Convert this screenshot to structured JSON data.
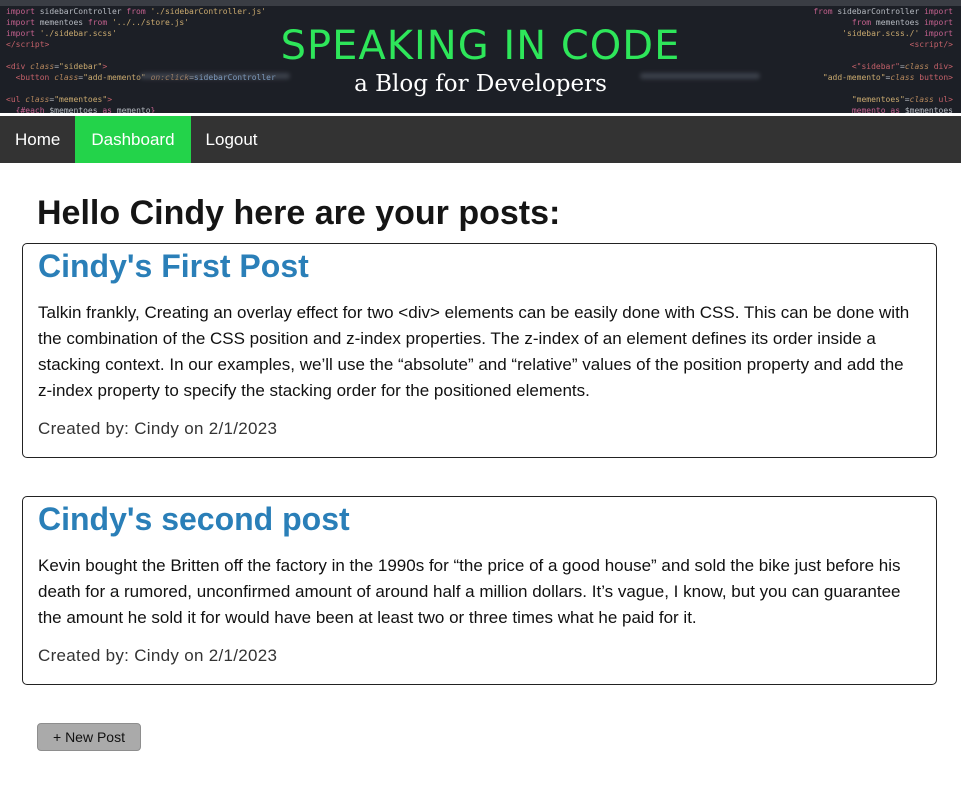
{
  "header": {
    "title": "SPEAKING IN CODE",
    "subtitle": "a Blog for Developers"
  },
  "nav": {
    "items": [
      {
        "label": "Home"
      },
      {
        "label": "Dashboard"
      },
      {
        "label": "Logout"
      }
    ],
    "active_color": "#23d34a",
    "bar_color": "#333333"
  },
  "main": {
    "greeting": "Hello Cindy here are your posts:",
    "posts": [
      {
        "title": "Cindy's First Post",
        "body": "Talkin frankly, Creating an overlay effect for two <div> elements can be easily done with CSS. This can be done with the combination of the CSS position and z-index properties. The z-index of an element defines its order inside a stacking context. In our examples, we’ll use the “absolute” and “relative” values of the position property and add the z-index property to specify the stacking order for the positioned elements.",
        "meta": "Created by: Cindy on 2/1/2023"
      },
      {
        "title": "Cindy's second post",
        "body": "Kevin bought the Britten off the factory in the 1990s for “the price of a good house” and sold the bike just before his death for a rumored, unconfirmed amount of around half a million dollars. It’s vague, I know, but you can guarantee the amount he sold it for would have been at least two or three times what he paid for it.",
        "meta": "Created by: Cindy on 2/1/2023"
      }
    ],
    "new_post_label": "+ New Post"
  }
}
